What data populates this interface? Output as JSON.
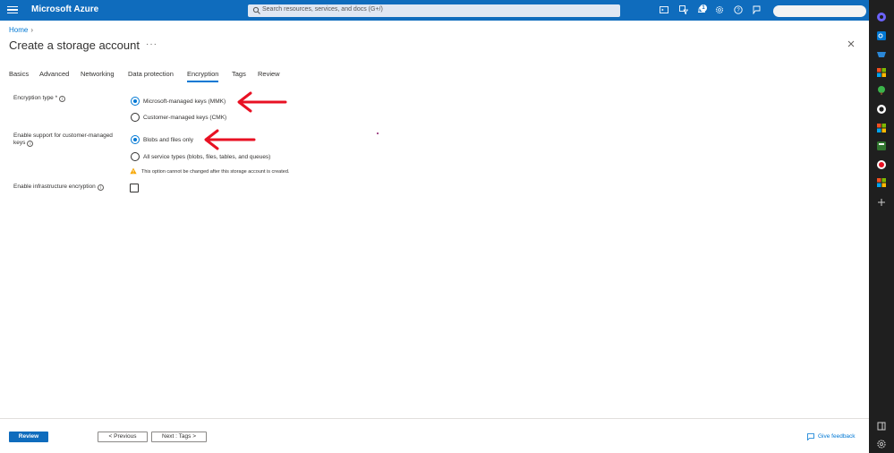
{
  "app": {
    "title": "Microsoft Azure"
  },
  "search": {
    "placeholder": "Search resources, services, and docs (G+/)"
  },
  "notifications": {
    "count": "1"
  },
  "breadcrumb": {
    "home": "Home"
  },
  "page": {
    "title": "Create a storage account"
  },
  "tabs": [
    {
      "label": "Basics"
    },
    {
      "label": "Advanced"
    },
    {
      "label": "Networking"
    },
    {
      "label": "Data protection"
    },
    {
      "label": "Encryption",
      "active": true
    },
    {
      "label": "Tags"
    },
    {
      "label": "Review"
    }
  ],
  "form": {
    "encryption_type": {
      "label": "Encryption type *",
      "options": [
        {
          "label": "Microsoft-managed keys (MMK)",
          "selected": true
        },
        {
          "label": "Customer-managed keys (CMK)",
          "selected": false
        }
      ]
    },
    "cmk_support": {
      "label": "Enable support for customer-managed keys",
      "options": [
        {
          "label": "Blobs and files only",
          "selected": true
        },
        {
          "label": "All service types (blobs, files, tables, and queues)",
          "selected": false
        }
      ],
      "warning": "This option cannot be changed after this storage account is created."
    },
    "infrastructure_encryption": {
      "label": "Enable infrastructure encryption",
      "checked": false
    }
  },
  "footer": {
    "review": "Review",
    "previous": "< Previous",
    "next": "Next : Tags >",
    "feedback": "Give feedback"
  },
  "colors": {
    "topbar": "#0f6cbd",
    "accent": "#0078d4",
    "annotation_arrow": "#e81123",
    "warning": "#f7a600"
  },
  "icons": [
    "hamburger-icon",
    "search-icon",
    "cloud-shell-icon",
    "directory-filter-icon",
    "bell-icon",
    "gear-icon",
    "help-icon",
    "feedback-person-icon",
    "info-icon",
    "warning-icon",
    "close-icon",
    "give-feedback-icon"
  ]
}
